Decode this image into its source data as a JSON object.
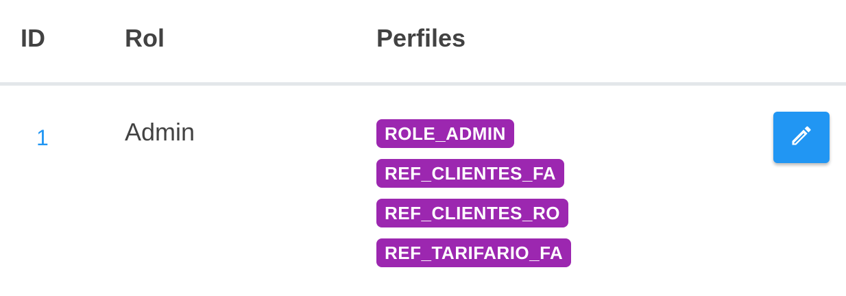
{
  "table": {
    "headers": {
      "id": "ID",
      "rol": "Rol",
      "perfiles": "Perfiles"
    },
    "rows": [
      {
        "id": "1",
        "rol": "Admin",
        "perfiles": [
          "ROLE_ADMIN",
          "REF_CLIENTES_FA",
          "REF_CLIENTES_RO",
          "REF_TARIFARIO_FA"
        ],
        "actions": {
          "edit_icon": "pencil-icon"
        }
      }
    ]
  },
  "colors": {
    "header_text": "#424242",
    "id_link": "#2196f3",
    "chip_bg": "#9c27b0",
    "edit_button_bg": "#2196f3",
    "divider": "#e3e7ea"
  }
}
